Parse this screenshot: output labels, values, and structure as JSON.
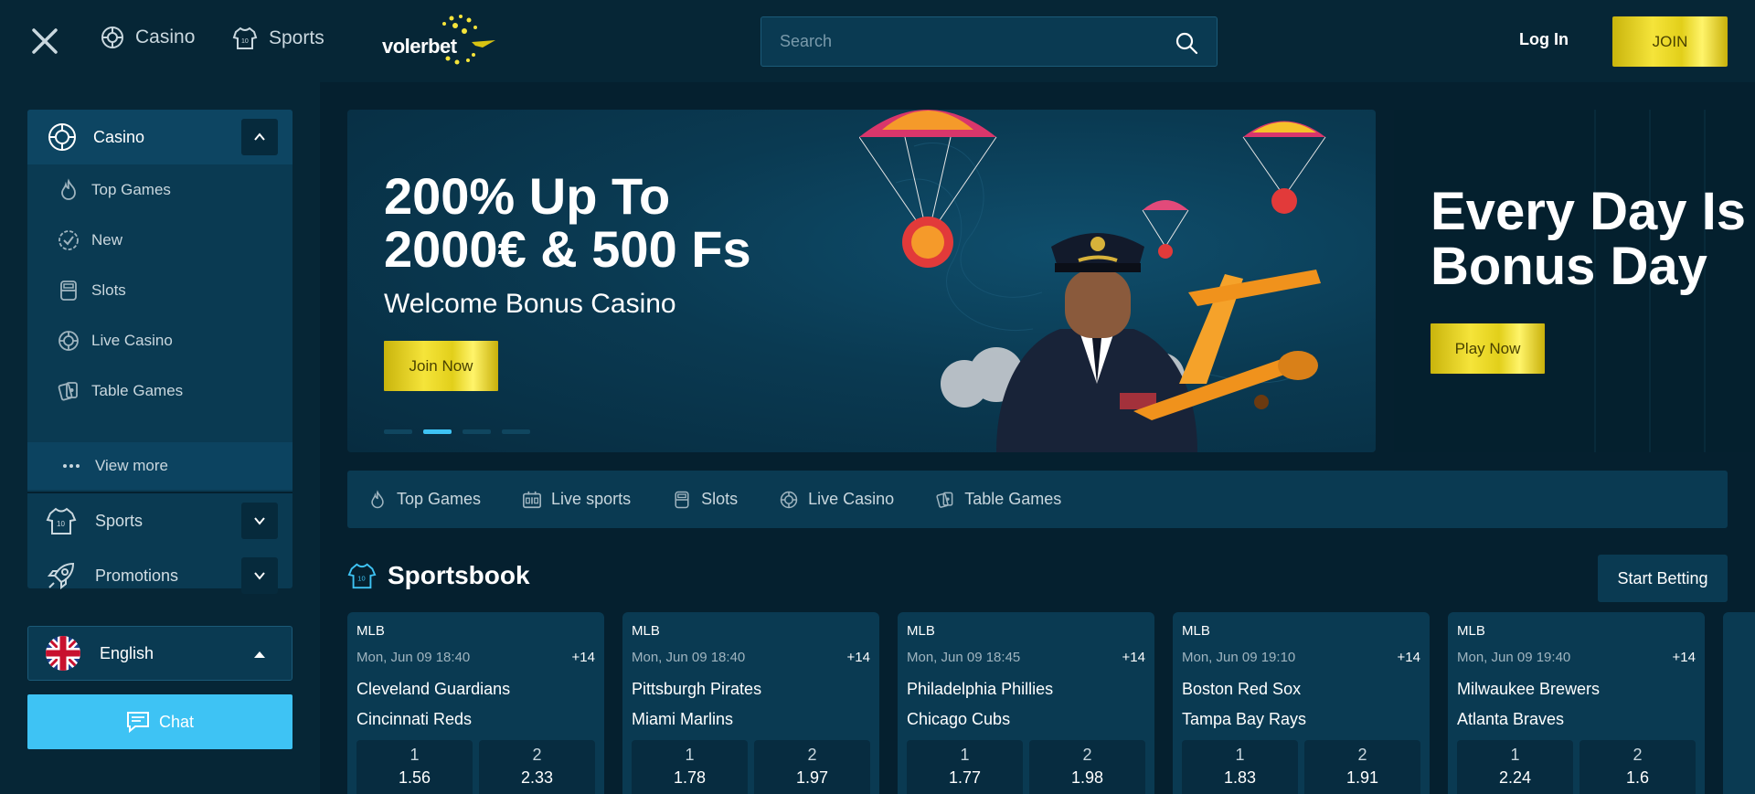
{
  "header": {
    "nav": [
      {
        "label": "Casino",
        "icon": "roulette-icon"
      },
      {
        "label": "Sports",
        "icon": "jersey-icon"
      }
    ],
    "logo_text": "volerbet",
    "search_placeholder": "Search",
    "login_label": "Log In",
    "join_label": "JOIN"
  },
  "sidebar": {
    "casino_label": "Casino",
    "casino_items": [
      {
        "label": "Top Games",
        "icon": "flame-icon"
      },
      {
        "label": "New",
        "icon": "badge-check-icon"
      },
      {
        "label": "Slots",
        "icon": "slot-machine-icon"
      },
      {
        "label": "Live Casino",
        "icon": "roulette-icon"
      },
      {
        "label": "Table Games",
        "icon": "cards-icon"
      }
    ],
    "view_more_label": "View more",
    "sports_label": "Sports",
    "promotions_label": "Promotions",
    "language_label": "English",
    "chat_label": "Chat"
  },
  "banner": {
    "title_line1": "200% Up To",
    "title_line2": "2000€ & 500 Fs",
    "subtitle": "Welcome Bonus Casino",
    "button_label": "Join Now",
    "slide_count": 4,
    "active_slide": 2
  },
  "banner2": {
    "title_line1": "Every Day Is",
    "title_line2": "Bonus Day",
    "button_label": "Play Now"
  },
  "categories": [
    {
      "label": "Top Games",
      "icon": "flame-icon"
    },
    {
      "label": "Live sports",
      "icon": "scoreboard-icon"
    },
    {
      "label": "Slots",
      "icon": "slot-machine-icon"
    },
    {
      "label": "Live Casino",
      "icon": "roulette-icon"
    },
    {
      "label": "Table Games",
      "icon": "cards-icon"
    }
  ],
  "sportsbook": {
    "title": "Sportsbook",
    "start_betting_label": "Start Betting",
    "events": [
      {
        "league": "MLB",
        "date": "Mon, Jun 09 18:40",
        "more": "+14",
        "home": "Cleveland Guardians",
        "away": "Cincinnati Reds",
        "odds": [
          {
            "label": "1",
            "value": "1.56"
          },
          {
            "label": "2",
            "value": "2.33"
          }
        ]
      },
      {
        "league": "MLB",
        "date": "Mon, Jun 09 18:40",
        "more": "+14",
        "home": "Pittsburgh Pirates",
        "away": "Miami Marlins",
        "odds": [
          {
            "label": "1",
            "value": "1.78"
          },
          {
            "label": "2",
            "value": "1.97"
          }
        ]
      },
      {
        "league": "MLB",
        "date": "Mon, Jun 09 18:45",
        "more": "+14",
        "home": "Philadelphia Phillies",
        "away": "Chicago Cubs",
        "odds": [
          {
            "label": "1",
            "value": "1.77"
          },
          {
            "label": "2",
            "value": "1.98"
          }
        ]
      },
      {
        "league": "MLB",
        "date": "Mon, Jun 09 19:10",
        "more": "+14",
        "home": "Boston Red Sox",
        "away": "Tampa Bay Rays",
        "odds": [
          {
            "label": "1",
            "value": "1.83"
          },
          {
            "label": "2",
            "value": "1.91"
          }
        ]
      },
      {
        "league": "MLB",
        "date": "Mon, Jun 09 19:40",
        "more": "+14",
        "home": "Milwaukee Brewers",
        "away": "Atlanta Braves",
        "odds": [
          {
            "label": "1",
            "value": "2.24"
          },
          {
            "label": "2",
            "value": "1.6"
          }
        ]
      }
    ]
  },
  "colors": {
    "background": "#05202f",
    "panel": "#0a3a52",
    "accent_blue": "#3ec3f4",
    "gold": "#f5e43a",
    "logo_dots": "#f5e43a"
  }
}
